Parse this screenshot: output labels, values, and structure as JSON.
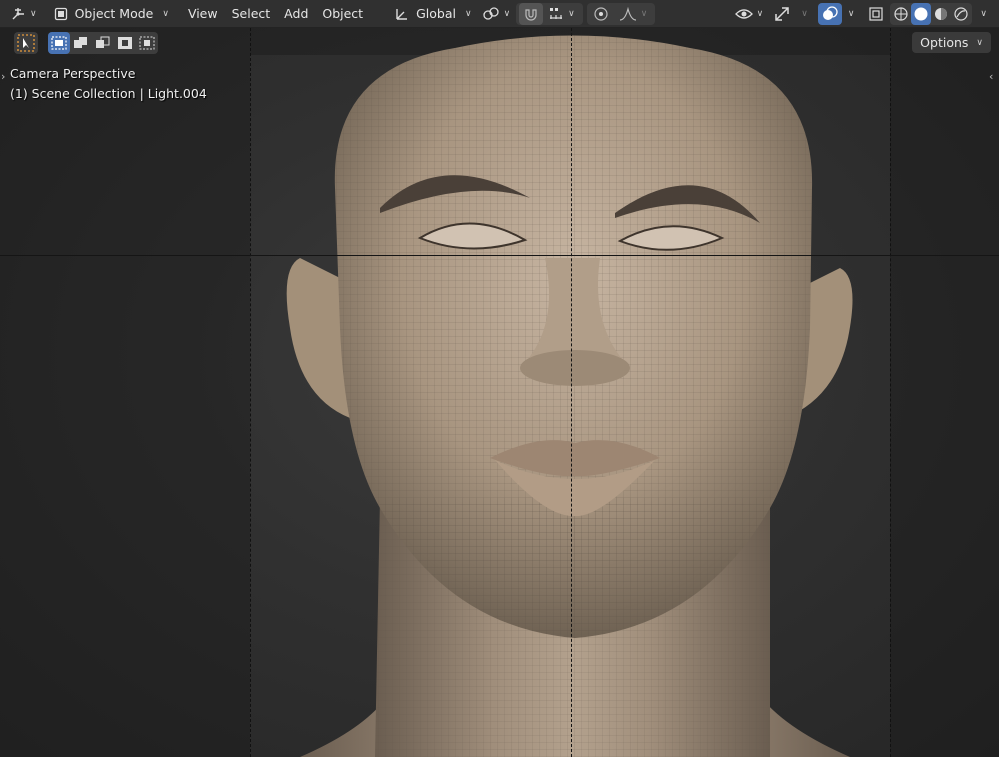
{
  "header": {
    "mode_label": "Object Mode",
    "menus": [
      "View",
      "Select",
      "Add",
      "Object"
    ],
    "orientation_label": "Global",
    "options_label": "Options"
  },
  "viewport": {
    "camera_label": "Camera Perspective",
    "collection_label": "(1) Scene Collection | Light.004"
  },
  "colors": {
    "accent": "#4772b3",
    "header_bg": "#303030",
    "skin": "#b3a08c"
  },
  "icons": {
    "editor_type": "transform-gizmo-icon",
    "mode": "object-mode-icon",
    "orientation": "transform-orientation-icon",
    "pivot": "pivot-point-icon",
    "snap": "magnet-icon",
    "snap_target": "snap-increment-icon",
    "proportional": "proportional-edit-icon",
    "falloff": "falloff-curve-icon",
    "visibility": "eye-icon",
    "gizmo": "gizmo-icon",
    "overlays": "overlays-icon",
    "xray": "xray-icon",
    "shading": [
      "wireframe-shading-icon",
      "solid-shading-icon",
      "material-shading-icon",
      "rendered-shading-icon"
    ],
    "select_tool": "select-box-tool-icon",
    "select_modes": [
      "select-new-icon",
      "select-extend-icon",
      "select-subtract-icon",
      "select-difference-icon",
      "select-intersect-icon"
    ]
  }
}
